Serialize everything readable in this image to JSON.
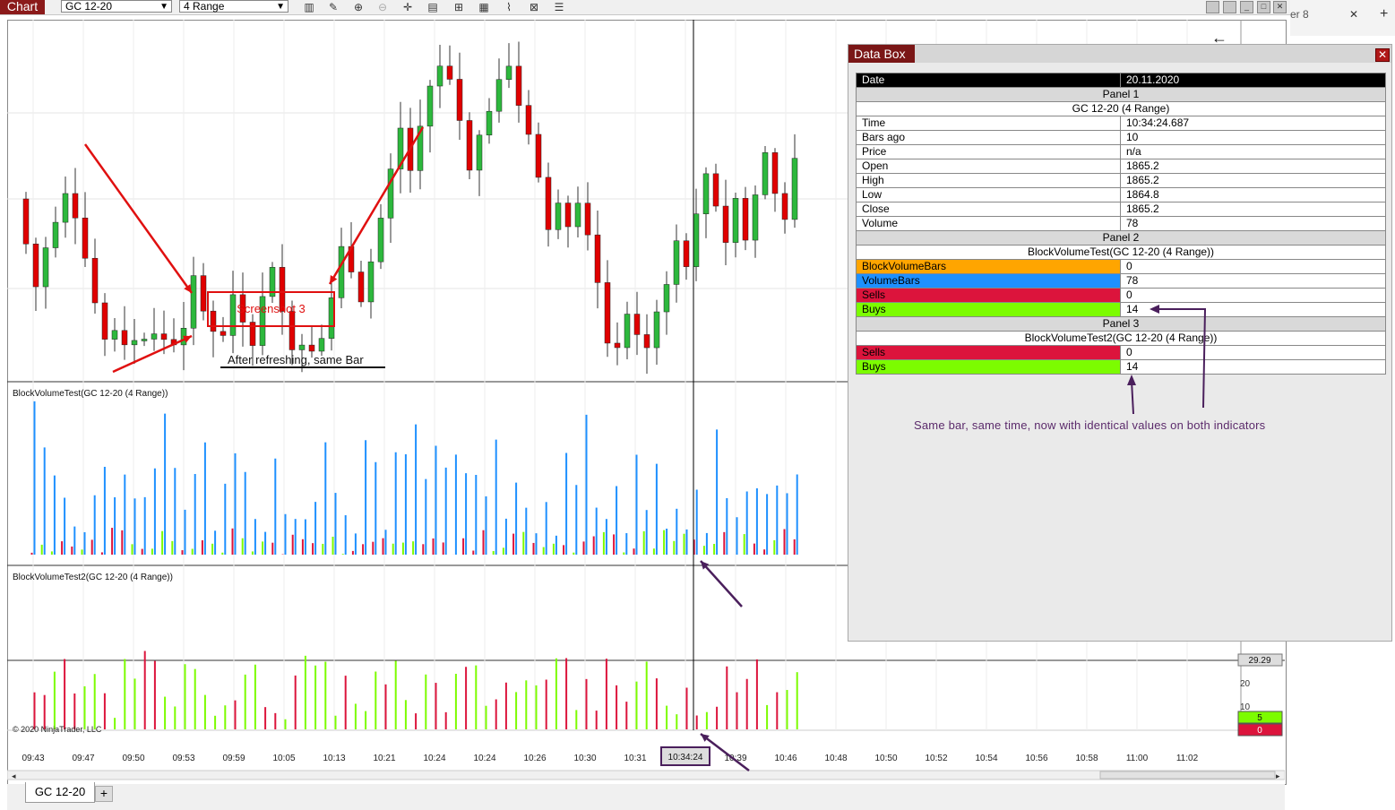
{
  "toolbar": {
    "chart_label": "Chart",
    "instrument": "GC 12-20",
    "period": "4 Range",
    "icons": [
      "bar-chart-icon",
      "pencil-icon",
      "zoom-in-icon",
      "zoom-out-icon",
      "crosshair-icon",
      "properties-icon",
      "indicators-icon",
      "strategies-icon",
      "draw-icon",
      "template-icon",
      "menu-icon"
    ]
  },
  "window_buttons": [
    "minimize-icon",
    "restore-icon",
    "maximize-icon",
    "close-icon"
  ],
  "browser_bg": {
    "tab_label": "er 8",
    "close": "✕",
    "new_tab": "+"
  },
  "data_box": {
    "title": "Data Box",
    "close": "✕",
    "header": {
      "key": "Date",
      "value": "20.11.2020"
    },
    "panel1": {
      "label": "Panel 1",
      "instrument": "GC 12-20 (4 Range)"
    },
    "panel1_rows": [
      {
        "key": "Time",
        "value": "10:34:24.687"
      },
      {
        "key": "Bars ago",
        "value": "10"
      },
      {
        "key": "Price",
        "value": "n/a"
      },
      {
        "key": "Open",
        "value": "1865.2"
      },
      {
        "key": "High",
        "value": "1865.2"
      },
      {
        "key": "Low",
        "value": "1864.8"
      },
      {
        "key": "Close",
        "value": "1865.2"
      },
      {
        "key": "Volume",
        "value": "78"
      }
    ],
    "panel2": {
      "label": "Panel 2",
      "indicator": "BlockVolumeTest(GC 12-20 (4 Range))"
    },
    "panel2_rows": [
      {
        "key": "BlockVolumeBars",
        "value": "0",
        "color": "#ffa500"
      },
      {
        "key": "VolumeBars",
        "value": "78",
        "color": "#1e90ff"
      },
      {
        "key": "Sells",
        "value": "0",
        "color": "#dc143c"
      },
      {
        "key": "Buys",
        "value": "14",
        "color": "#7cfc00"
      }
    ],
    "panel3": {
      "label": "Panel 3",
      "indicator": "BlockVolumeTest2(GC 12-20 (4 Range))"
    },
    "panel3_rows": [
      {
        "key": "Sells",
        "value": "0",
        "color": "#dc143c"
      },
      {
        "key": "Buys",
        "value": "14",
        "color": "#7cfc00"
      }
    ],
    "note": "Same bar, same time, now with identical values on both indicators"
  },
  "annotations": {
    "screenshot_label": "Screenshot 3",
    "after_refresh": "After refreshing, same Bar"
  },
  "chart": {
    "panel2_label": "BlockVolumeTest(GC 12-20 (4 Range))",
    "panel3_label": "BlockVolumeTest2(GC 12-20 (4 Range))",
    "copyright": "© 2020 NinjaTrader, LLC",
    "crosshair_time": "10:34:24",
    "price_marker": "29.29",
    "axis_20": "20",
    "axis_10": "10",
    "buy_tag": "5",
    "sell_tag": "0",
    "colors": {
      "up": "#2db83d",
      "down": "#e00000",
      "buy": "#7cfc00",
      "sell": "#dc143c",
      "volume": "#1e90ff"
    }
  },
  "time_axis": [
    "09:43",
    "09:47",
    "09:50",
    "09:53",
    "09:59",
    "10:05",
    "10:13",
    "10:21",
    "10:24",
    "10:24",
    "10:26",
    "10:30",
    "10:31",
    "10:34:24",
    "10:39",
    "10:46",
    "10:48",
    "10:50",
    "10:52",
    "10:54",
    "10:56",
    "10:58",
    "11:00",
    "11:02"
  ],
  "tabs": {
    "active": "GC 12-20",
    "add": "+"
  }
}
